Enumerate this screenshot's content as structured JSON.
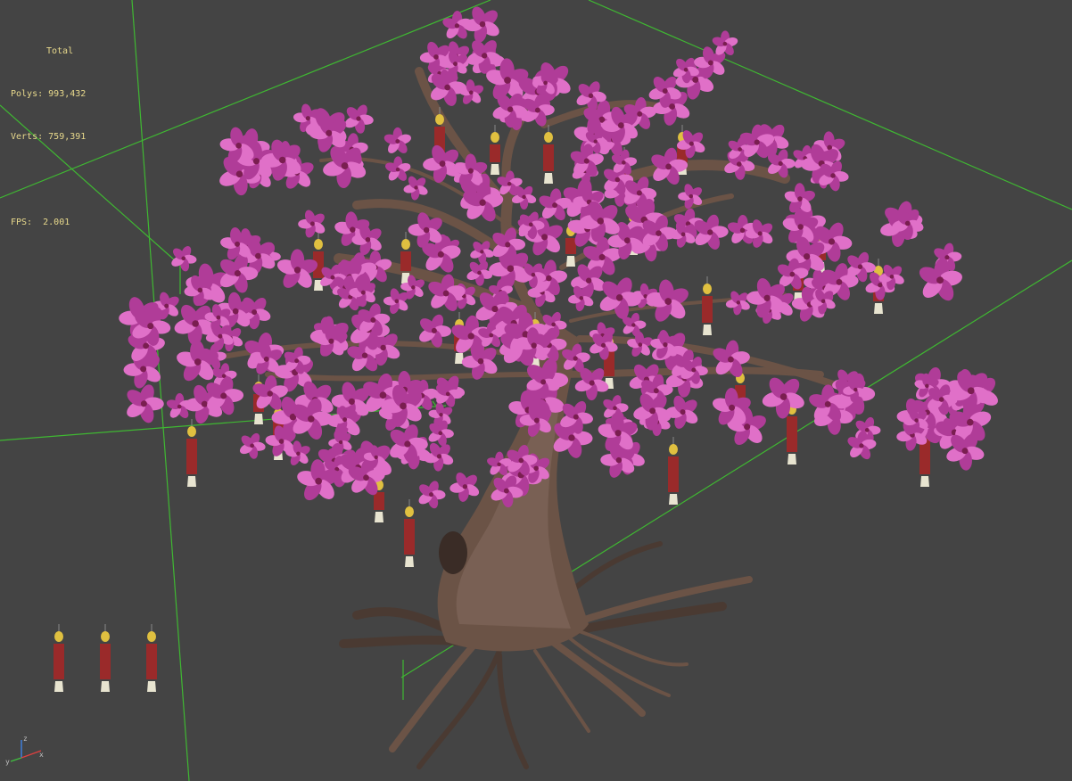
{
  "viewport": {
    "background": "#444444",
    "grid_color": "#3fb832",
    "stats": {
      "title": "Total",
      "polys_label": "Polys:",
      "polys_value": "993,432",
      "verts_label": "Verts:",
      "verts_value": "759,391",
      "fps_label": "FPS:",
      "fps_value": "2.001"
    },
    "colors": {
      "blossom": "#e070c8",
      "blossom_dark": "#b03c98",
      "bark": "#6b5346",
      "bark_dark": "#4a3a32",
      "ornament_gold": "#e0c040",
      "ornament_red": "#9a2a2a",
      "tassel": "#e8e4d0"
    }
  },
  "axis": {
    "z": "z",
    "x": "x",
    "y": "y"
  },
  "icons": {
    "axis_gizmo": "axis-tripod-icon"
  }
}
